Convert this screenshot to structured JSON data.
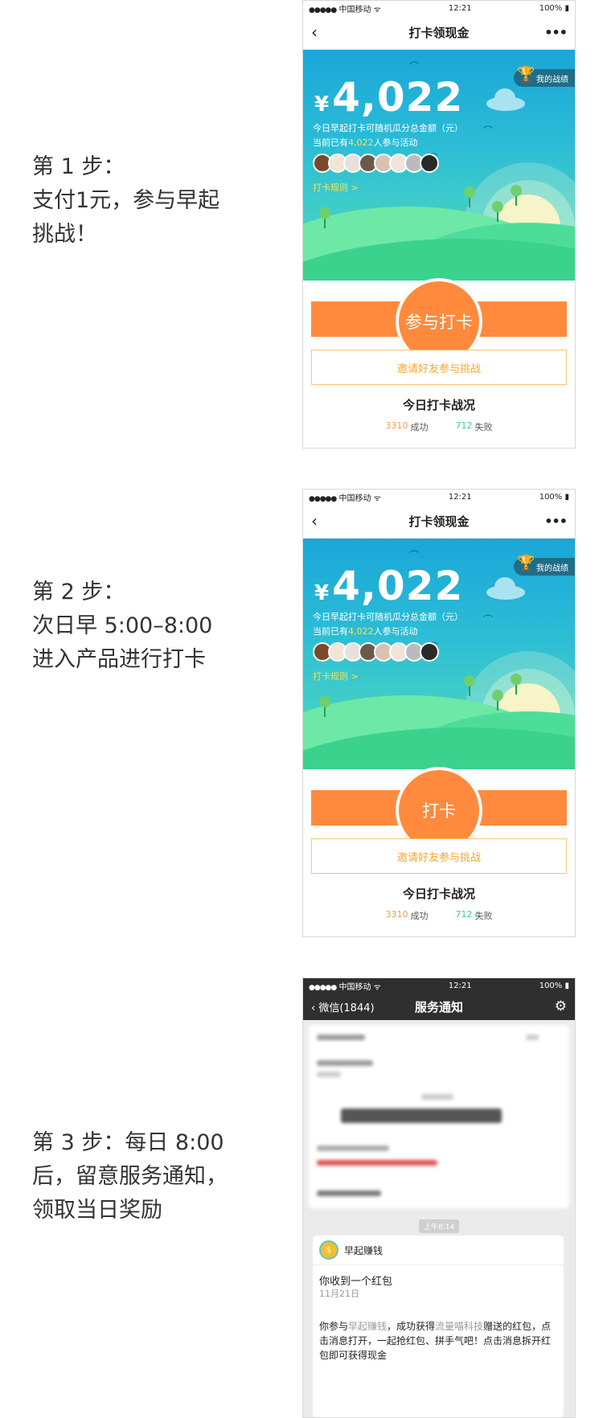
{
  "steps": [
    {
      "lines": [
        "第 1 步：",
        "支付1元，参与早起",
        "挑战！"
      ]
    },
    {
      "lines": [
        "第 2 步：",
        "次日早 5:00–8:00",
        "进入产品进行打卡"
      ]
    },
    {
      "lines": [
        "第 3 步：每日 8:00",
        "后，留意服务通知，",
        "领取当日奖励"
      ]
    }
  ],
  "status": {
    "carrier": "中国移动",
    "signal": "●●●●●",
    "wifi": "ᯤ",
    "time": "12:21",
    "battery": "100%",
    "battery_icon": "▮"
  },
  "checkin_page": {
    "title": "打卡领现金",
    "back": "‹",
    "more": "•••",
    "my_record": "我的战绩",
    "currency": "¥",
    "amount": "4,022",
    "desc1": "今日早起打卡可随机瓜分总金额（元）",
    "desc2_prefix": "当前已有",
    "participants": "4,022",
    "desc2_suffix": "人参与活动",
    "rules_link": "打卡规则 >",
    "invite": "邀请好友参与挑战",
    "today_title": "今日打卡战况",
    "success_count": "3310",
    "success_label": "成功",
    "fail_count": "712",
    "fail_label": "失败"
  },
  "join_button": "参与打卡",
  "checkin_button": "打卡",
  "notify_page": {
    "back": "微信(1844)",
    "title": "服务通知",
    "time_label": "上午8:14",
    "app_name": "早起赚钱",
    "msg_title": "你收到一个红包",
    "msg_date": "11月21日",
    "body_p1": "你参与",
    "body_kw1": "早起赚钱",
    "body_p2": "，成功获得",
    "body_kw2": "流量喵科技",
    "body_p3": "赠送的红包，点击消息打开，一起抢红包、拼手气吧！点击消息拆开红包即可获得现金"
  }
}
